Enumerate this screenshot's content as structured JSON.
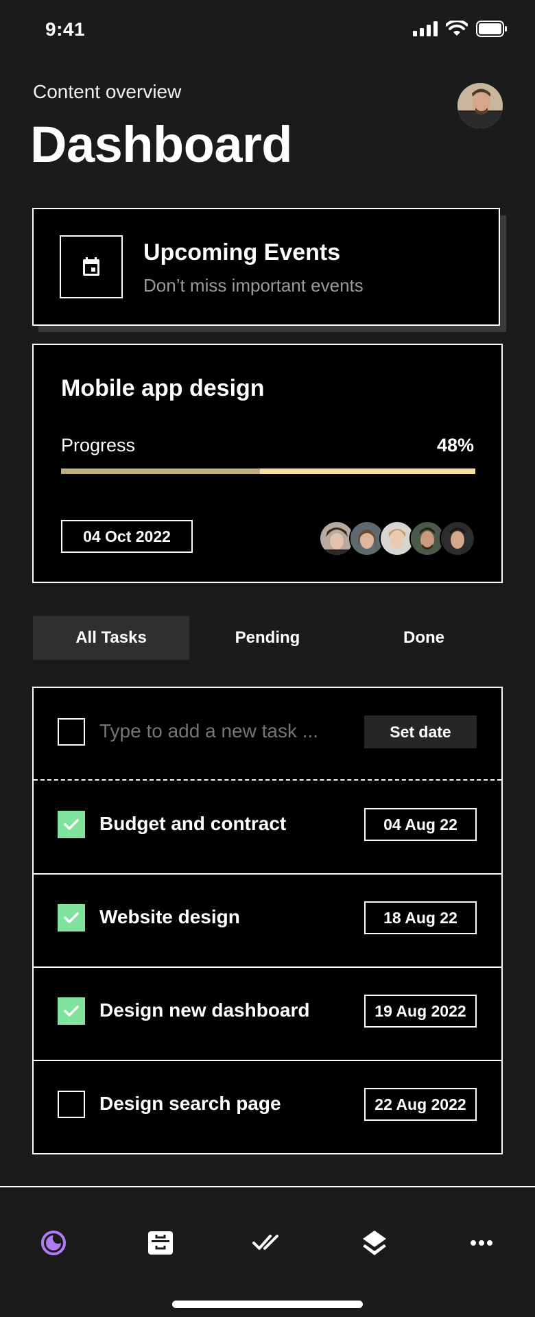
{
  "status_bar": {
    "time": "9:41"
  },
  "header": {
    "subtitle": "Content overview",
    "title": "Dashboard"
  },
  "events_card": {
    "title": "Upcoming Events",
    "subtitle": "Don’t miss important events"
  },
  "project_card": {
    "title": "Mobile app design",
    "progress_label": "Progress",
    "progress_value": "48%",
    "progress_fraction": 0.48,
    "date": "04 Oct 2022",
    "member_count": 5
  },
  "tabs": [
    {
      "label": "All Tasks",
      "active": true
    },
    {
      "label": "Pending",
      "active": false
    },
    {
      "label": "Done",
      "active": false
    }
  ],
  "new_task": {
    "placeholder": "Type to add a new task ...",
    "set_date_label": "Set date"
  },
  "tasks": [
    {
      "label": "Budget and contract",
      "date": "04 Aug 22",
      "done": true
    },
    {
      "label": "Website design",
      "date": "18 Aug 22",
      "done": true
    },
    {
      "label": "Design new dashboard",
      "date": "19 Aug 2022",
      "done": true
    },
    {
      "label": "Design search page",
      "date": "22 Aug 2022",
      "done": false
    }
  ],
  "bottom_nav": [
    {
      "icon": "dashboard-pie-icon",
      "active": true
    },
    {
      "icon": "inbox-icon",
      "active": false
    },
    {
      "icon": "double-check-icon",
      "active": false
    },
    {
      "icon": "layers-icon",
      "active": false
    },
    {
      "icon": "more-icon",
      "active": false
    }
  ],
  "colors": {
    "background": "#1b1b1b",
    "card": "#000000",
    "check_green": "#7fe39b",
    "progress_light": "#f5e0a0",
    "progress_dark": "#bfae80",
    "nav_active": "#b07cf5"
  }
}
